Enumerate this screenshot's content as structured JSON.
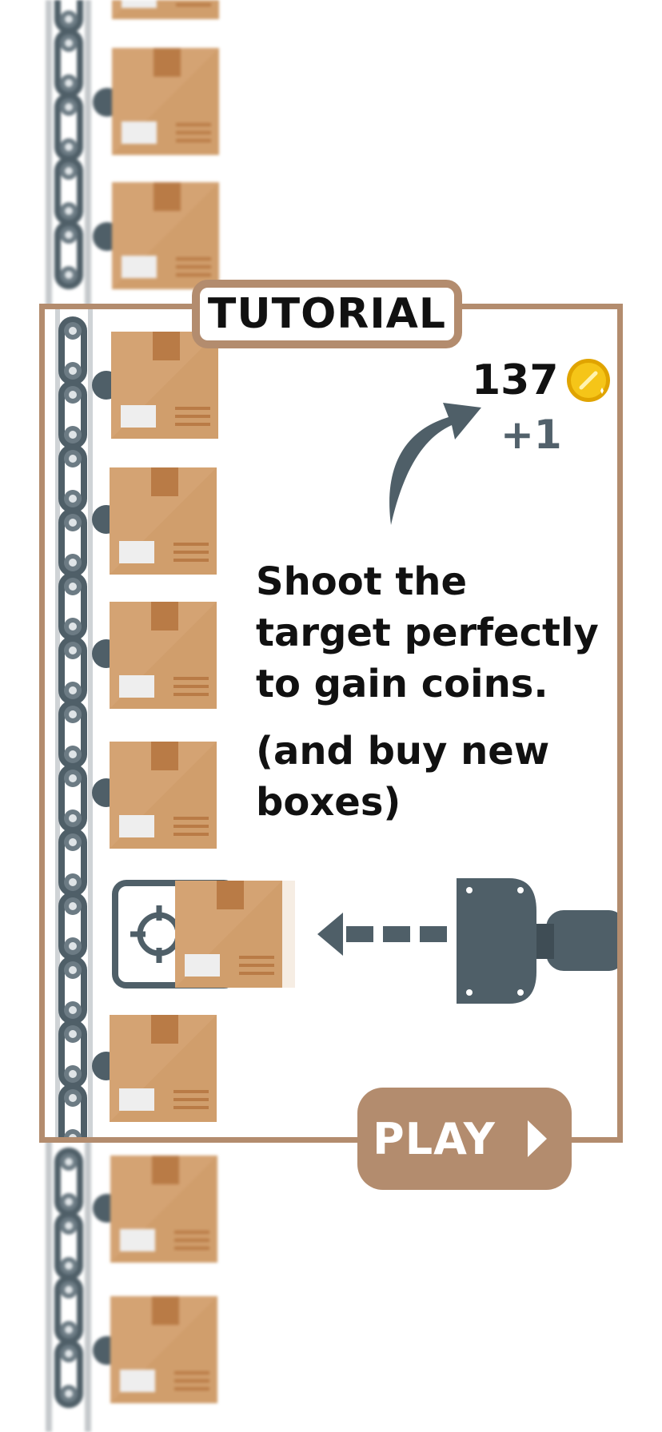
{
  "tutorial": {
    "title": "TUTORIAL",
    "coin_count": "137",
    "coin_gain": "+1",
    "instruction_1": "Shoot the target perfectly to gain coins.",
    "instruction_2": "(and buy new boxes)"
  },
  "play_button": {
    "label": "PLAY"
  },
  "colors": {
    "frame": "#b38c6e",
    "box": "#d4a373",
    "box_shade": "#b97b46",
    "box_label": "#eeeeee",
    "machine": "#4f5f68",
    "coin": "#f5c518"
  },
  "icons": [
    "coin-icon",
    "curved-arrow-icon",
    "crosshair-icon",
    "dashed-arrow-left-icon",
    "chevron-right-icon"
  ]
}
